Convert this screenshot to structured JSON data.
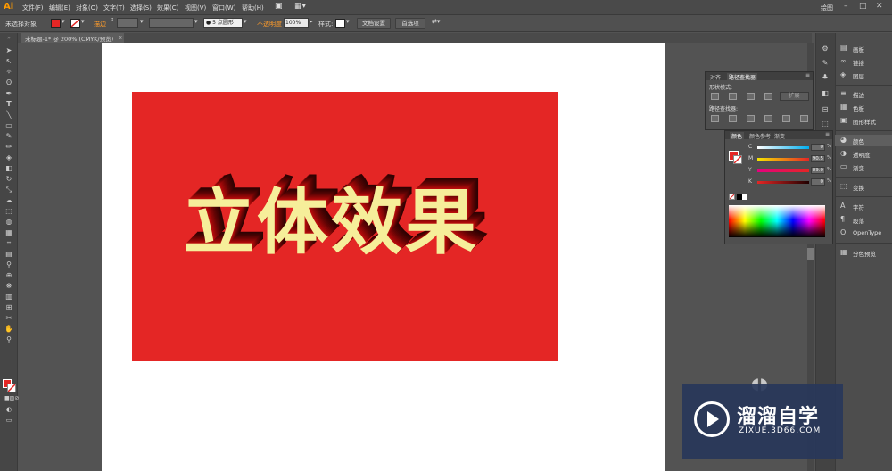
{
  "app": {
    "logo": "Ai"
  },
  "menu": [
    "文件(F)",
    "编辑(E)",
    "对象(O)",
    "文字(T)",
    "选择(S)",
    "效果(C)",
    "视图(V)",
    "窗口(W)",
    "帮助(H)"
  ],
  "window": {
    "workspace": "绘图",
    "min": "–",
    "max": "□",
    "close": "✕"
  },
  "controlbar": {
    "selection": "未选择对象",
    "stroke_label": "描边",
    "brush": "5 点圆形",
    "opacity_label": "不透明度",
    "opacity_value": "100%",
    "style_label": "样式:",
    "doc_setup": "文档设置",
    "preferences": "首选项"
  },
  "document": {
    "tab": "未标题-1* @ 200% (CMYK/预览)",
    "close": "×"
  },
  "artwork": {
    "title": "立体效果",
    "background_color": "#e42625",
    "text_color": "#f6ee9a"
  },
  "pathfinder": {
    "tabs": [
      "对齐",
      "路径查找器"
    ],
    "shape_modes_label": "形状模式:",
    "expand_label": "扩展",
    "pathfinders_label": "路径查找器:"
  },
  "color_panel": {
    "tabs": [
      "颜色",
      "颜色参考",
      "渐变"
    ],
    "channels": [
      {
        "letter": "C",
        "value": "0"
      },
      {
        "letter": "M",
        "value": "90.5"
      },
      {
        "letter": "Y",
        "value": "89.0"
      },
      {
        "letter": "K",
        "value": "0"
      }
    ],
    "pct": "%"
  },
  "dock": [
    {
      "label": "画板",
      "icon": "artboards-icon"
    },
    {
      "label": "链接",
      "icon": "links-icon"
    },
    {
      "label": "图层",
      "icon": "layers-icon"
    },
    {
      "label": "描边",
      "icon": "stroke-icon"
    },
    {
      "label": "色板",
      "icon": "swatches-icon"
    },
    {
      "label": "图形样式",
      "icon": "graphic-styles-icon"
    },
    {
      "label": "颜色",
      "icon": "color-icon"
    },
    {
      "label": "透明度",
      "icon": "transparency-icon"
    },
    {
      "label": "渐变",
      "icon": "gradient-icon"
    },
    {
      "label": "变换",
      "icon": "transform-icon"
    },
    {
      "label": "字符",
      "icon": "character-icon"
    },
    {
      "label": "段落",
      "icon": "paragraph-icon"
    },
    {
      "label": "OpenType",
      "icon": "opentype-icon"
    },
    {
      "label": "分色预览",
      "icon": "separations-icon"
    }
  ],
  "watermark": {
    "title": "溜溜自学",
    "url": "ZIXUE.3D66.COM"
  }
}
